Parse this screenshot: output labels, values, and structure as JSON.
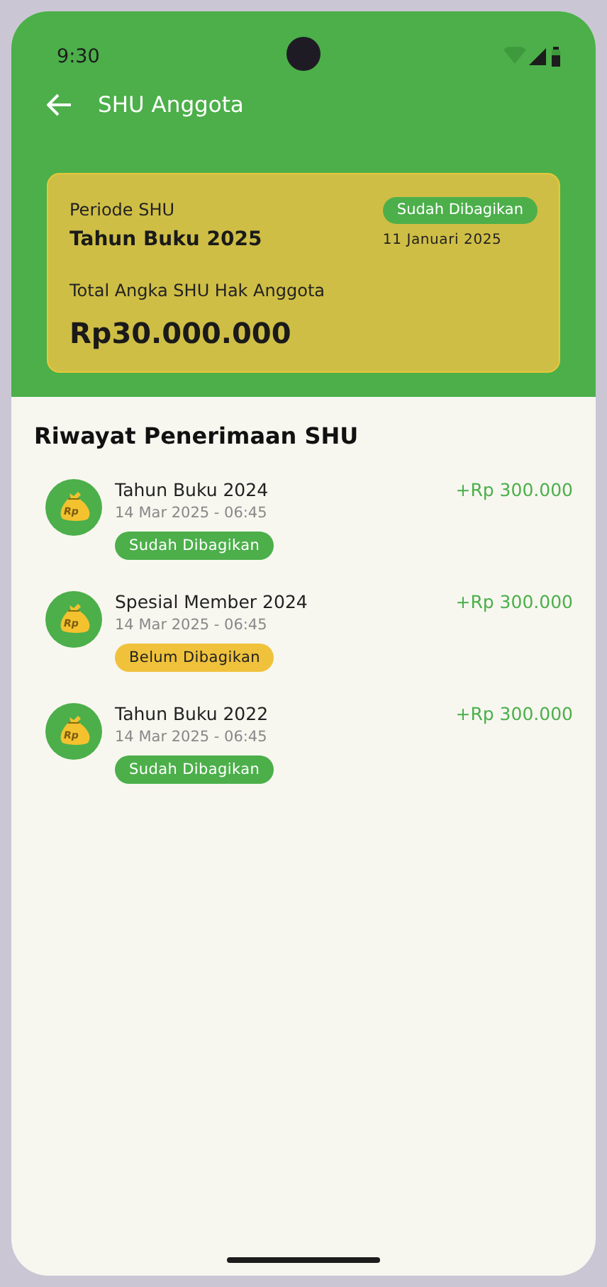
{
  "status_bar": {
    "time": "9:30"
  },
  "app_bar": {
    "title": "SHU Anggota"
  },
  "summary_card": {
    "period_label": "Periode SHU",
    "period": "Tahun Buku 2025",
    "status": {
      "label": "Sudah Dibagikan",
      "kind": "distributed"
    },
    "date": "11 Januari 2025",
    "total_label": "Total Angka SHU Hak Anggota",
    "total": "Rp30.000.000"
  },
  "history": {
    "title": "Riwayat Penerimaan SHU",
    "items": [
      {
        "icon_label": "Rp",
        "title": "Tahun Buku 2024",
        "datetime": "14 Mar 2025 - 06:45",
        "amount": "+Rp 300.000",
        "status": {
          "label": "Sudah Dibagikan",
          "kind": "distributed"
        }
      },
      {
        "icon_label": "Rp",
        "title": "Spesial Member 2024",
        "datetime": "14 Mar 2025 - 06:45",
        "amount": "+Rp 300.000",
        "status": {
          "label": "Belum Dibagikan",
          "kind": "pending"
        }
      },
      {
        "icon_label": "Rp",
        "title": "Tahun Buku 2022",
        "datetime": "14 Mar 2025 - 06:45",
        "amount": "+Rp 300.000",
        "status": {
          "label": "Sudah Dibagikan",
          "kind": "distributed"
        }
      }
    ]
  }
}
